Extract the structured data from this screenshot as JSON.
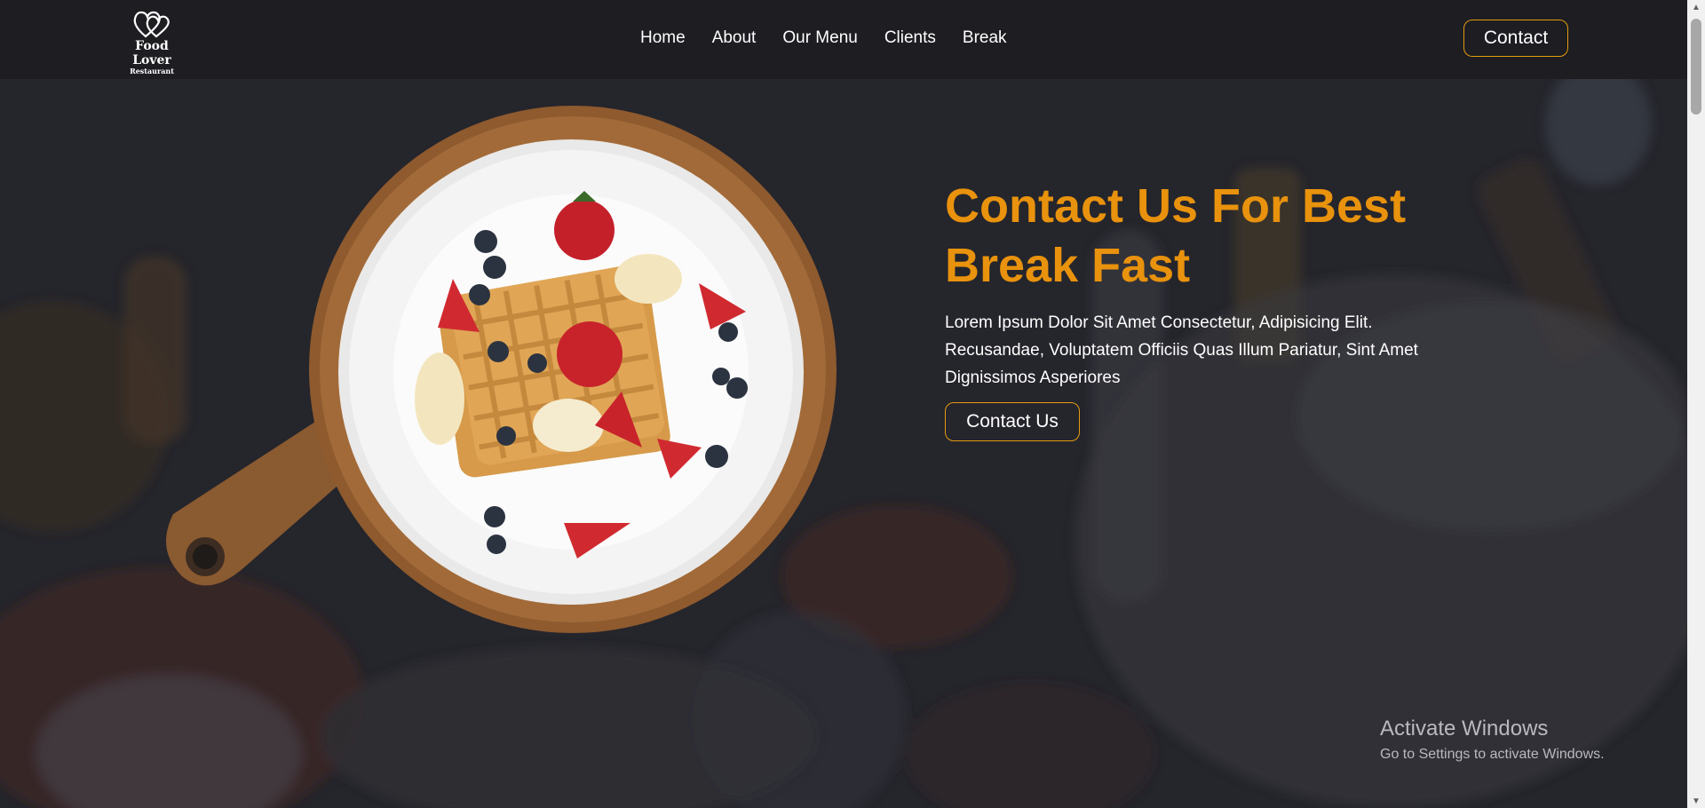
{
  "brand": {
    "logo_icon": "double-heart-icon",
    "name": "Food Lover",
    "tagline": "Restaurant"
  },
  "nav": {
    "items": [
      {
        "label": "Home"
      },
      {
        "label": "About"
      },
      {
        "label": "Our Menu"
      },
      {
        "label": "Clients"
      },
      {
        "label": "Break"
      }
    ],
    "contact_button": "Contact"
  },
  "hero": {
    "title": "Contact Us For Best Break Fast",
    "description": "Lorem Ipsum Dolor Sit Amet Consectetur, Adipisicing Elit. Recusandae, Voluptatem Officiis Quas Illum Pariatur, Sint Amet Dignissimos Asperiores",
    "button": "Contact Us",
    "image_subject": "waffle-breakfast-plate"
  },
  "os_watermark": {
    "title": "Activate Windows",
    "subtitle": "Go to Settings to activate Windows."
  },
  "colors": {
    "accent": "#e8920d",
    "header_bg": "#1d1d22",
    "hero_bg": "#25252c",
    "text": "#ffffff"
  }
}
